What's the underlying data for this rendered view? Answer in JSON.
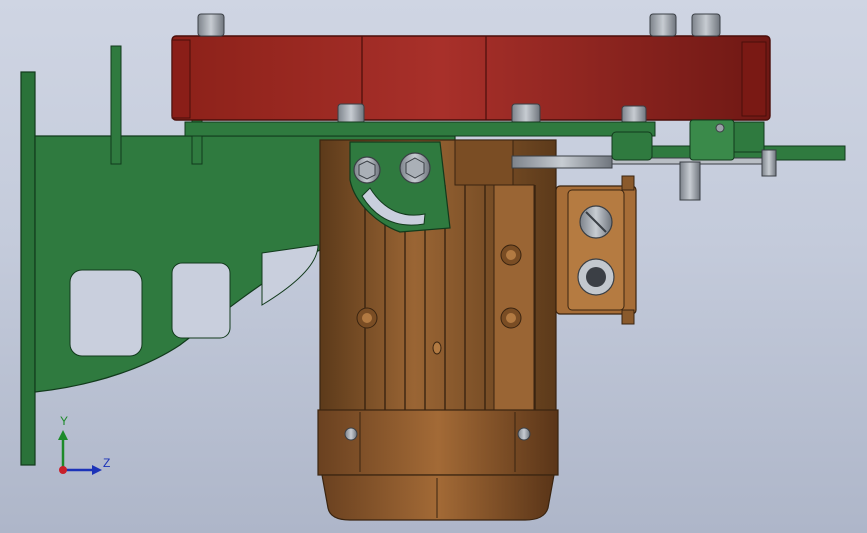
{
  "viewport": {
    "background_top": "#cfd5e3",
    "background_bottom": "#aeb6c9"
  },
  "model": {
    "colors": {
      "bracket": "#2f7a3f",
      "bracket_dark": "#1e5a2c",
      "pulley": "#a22a22",
      "pulley_dark": "#7a1a16",
      "motor": "#8b5a2b",
      "motor_dark": "#5c3a1a",
      "bolt": "#9aa0a8"
    },
    "icons": [
      "mounting-bracket",
      "drive-pulley",
      "electric-motor",
      "terminal-box",
      "tension-rod"
    ]
  },
  "triad": {
    "y_label": "Y",
    "z_label": "Z",
    "y_color": "#1d8a2a",
    "z_color": "#1c33b8",
    "x_color": "#c8202a"
  }
}
